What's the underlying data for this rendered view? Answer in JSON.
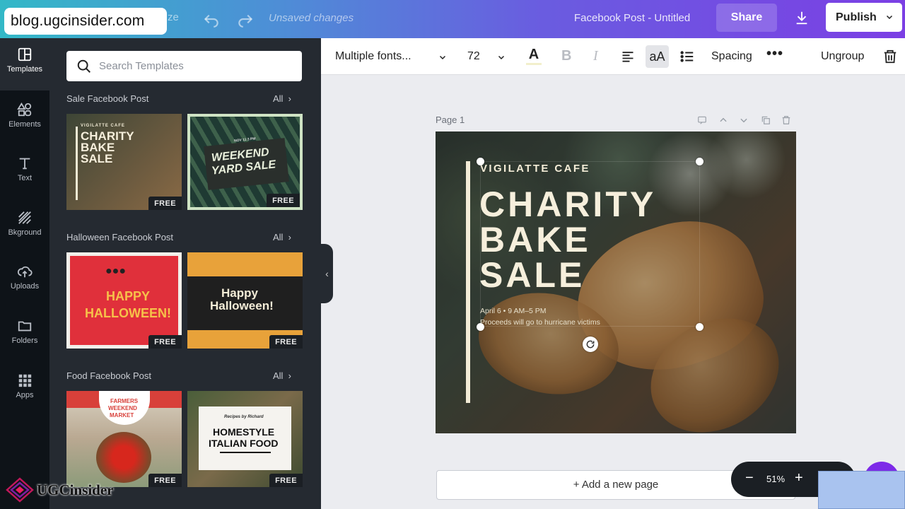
{
  "watermark": "blog.ugcinsider.com",
  "topbar": {
    "resize_fragment": "ze",
    "undo_icon": "undo-icon",
    "redo_icon": "redo-icon",
    "status": "Unsaved changes",
    "doc_title": "Facebook Post - Untitled",
    "share_label": "Share",
    "download_icon": "download-icon",
    "publish_label": "Publish"
  },
  "rail": {
    "items": [
      {
        "label": "Templates",
        "icon": "templates-icon"
      },
      {
        "label": "Elements",
        "icon": "elements-icon"
      },
      {
        "label": "Text",
        "icon": "text-icon"
      },
      {
        "label": "Bkground",
        "icon": "background-icon"
      },
      {
        "label": "Uploads",
        "icon": "uploads-icon"
      },
      {
        "label": "Folders",
        "icon": "folders-icon"
      },
      {
        "label": "Apps",
        "icon": "apps-icon"
      }
    ]
  },
  "panel": {
    "search_placeholder": "Search Templates",
    "sections": [
      {
        "title": "Sale Facebook Post",
        "all": "All",
        "templates": [
          {
            "top": "VIGILATTE CAFE",
            "l1": "CHARITY",
            "l2": "BAKE",
            "l3": "SALE",
            "badge": "FREE"
          },
          {
            "top": "NOV 11 3 PM",
            "l1": "WEEKEND",
            "l2": "YARD SALE",
            "badge": "FREE"
          }
        ]
      },
      {
        "title": "Halloween Facebook Post",
        "all": "All",
        "templates": [
          {
            "l1": "HAPPY",
            "l2": "HALLOWEEN!",
            "badge": "FREE"
          },
          {
            "l1": "Happy",
            "l2": "Halloween!",
            "badge": "FREE"
          }
        ]
      },
      {
        "title": "Food Facebook Post",
        "all": "All",
        "templates": [
          {
            "l1": "FARMERS",
            "l2": "WEEKEND",
            "l3": "MARKET",
            "badge": "FREE"
          },
          {
            "top": "Recipes by Richard",
            "l1": "HOMESTYLE",
            "l2": "ITALIAN FOOD",
            "badge": "FREE"
          }
        ]
      }
    ]
  },
  "toolbar": {
    "font": "Multiple fonts...",
    "size": "72",
    "text_color_glyph": "A",
    "bold_glyph": "B",
    "italic_glyph": "I",
    "case_label": "aA",
    "spacing_label": "Spacing",
    "more_label": "•••",
    "ungroup_label": "Ungroup",
    "text_color": "#f2efcc"
  },
  "canvas": {
    "page_label": "Page 1",
    "design": {
      "cafe": "VIGILATTE CAFE",
      "line1": "CHARITY",
      "line2": "BAKE",
      "line3": "SALE",
      "date": "April 6 • 9 AM–5 PM",
      "proceeds": "Proceeds will go to hurricane victims"
    },
    "add_page_label": "+ Add a new page"
  },
  "zoom": {
    "minus": "−",
    "value": "51%",
    "plus": "+"
  },
  "brand": {
    "name": "UGCinsider"
  },
  "colors": {
    "accent": "#7d2ae8",
    "panel_bg": "#252a31",
    "rail_bg": "#0e1318"
  }
}
